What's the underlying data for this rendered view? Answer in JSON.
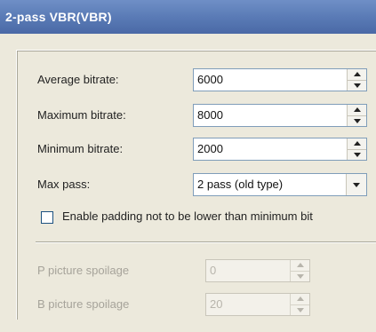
{
  "window": {
    "title": "2-pass VBR(VBR)"
  },
  "fields": {
    "average_bitrate": {
      "label": "Average bitrate:",
      "value": "6000"
    },
    "maximum_bitrate": {
      "label": "Maximum bitrate:",
      "value": "8000"
    },
    "minimum_bitrate": {
      "label": "Minimum bitrate:",
      "value": "2000"
    },
    "max_pass": {
      "label": "Max pass:",
      "value": "2 pass (old type)"
    }
  },
  "checkbox": {
    "label": "Enable padding not to be lower than minimum bit",
    "checked": false
  },
  "disabled_fields": {
    "p_picture_spoilage": {
      "label": "P picture spoilage",
      "value": "0"
    },
    "b_picture_spoilage": {
      "label": "B picture spoilage",
      "value": "20"
    }
  }
}
